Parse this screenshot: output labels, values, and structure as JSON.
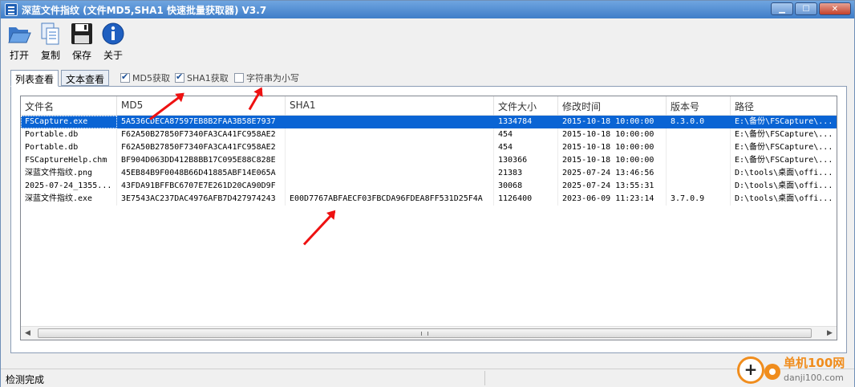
{
  "window": {
    "title": "深蓝文件指纹 (文件MD5,SHA1 快速批量获取器) V3.7",
    "minimize": "▁",
    "maximize": "☐",
    "close": "✕"
  },
  "toolbar": {
    "open_label": "打开",
    "copy_label": "复制",
    "save_label": "保存",
    "about_label": "关于"
  },
  "tabs": [
    {
      "label": "列表查看",
      "active": true
    },
    {
      "label": "文本查看",
      "active": false
    }
  ],
  "options": {
    "md5": {
      "label": "MD5获取",
      "checked": true
    },
    "sha1": {
      "label": "SHA1获取",
      "checked": true
    },
    "lowercase": {
      "label": "字符串为小写",
      "checked": false
    }
  },
  "table": {
    "columns": [
      "文件名",
      "MD5",
      "SHA1",
      "文件大小",
      "修改时间",
      "版本号",
      "路径"
    ],
    "rows": [
      [
        "FSCapture.exe",
        "5A536CDECA87597EB8B2FAA3B58E7937",
        "",
        "1334784",
        "2015-10-18 10:00:00",
        "8.3.0.0",
        "E:\\备份\\FSCapture\\..."
      ],
      [
        "Portable.db",
        "F62A50B27850F7340FA3CA41FC958AE2",
        "",
        "454",
        "2015-10-18 10:00:00",
        "",
        "E:\\备份\\FSCapture\\..."
      ],
      [
        "Portable.db",
        "F62A50B27850F7340FA3CA41FC958AE2",
        "",
        "454",
        "2015-10-18 10:00:00",
        "",
        "E:\\备份\\FSCapture\\..."
      ],
      [
        "FSCaptureHelp.chm",
        "BF904D063DD412B8BB17C095E88C828E",
        "",
        "130366",
        "2015-10-18 10:00:00",
        "",
        "E:\\备份\\FSCapture\\..."
      ],
      [
        "深蓝文件指纹.png",
        "45EB84B9F0048B66D41885ABF14E065A",
        "",
        "21383",
        "2025-07-24 13:46:56",
        "",
        "D:\\tools\\桌面\\offi..."
      ],
      [
        "2025-07-24_1355...",
        "43FDA91BFFBC6707E7E261D20CA90D9F",
        "",
        "30068",
        "2025-07-24 13:55:31",
        "",
        "D:\\tools\\桌面\\offi..."
      ],
      [
        "深蓝文件指纹.exe",
        "3E7543AC237DAC4976AFB7D427974243",
        "E00D7767ABFAECF03FBCDA96FDEA8FF531D25F4A",
        "1126400",
        "2023-06-09 11:23:14",
        "3.7.0.9",
        "D:\\tools\\桌面\\offi..."
      ]
    ],
    "selected_row": 0
  },
  "status": {
    "text": "检测完成"
  },
  "watermark": {
    "name": "单机100网",
    "url": "danji100.com"
  },
  "colors": {
    "selection": "#0a64d4",
    "arrow": "#e11111",
    "title_gradient_top": "#6fa5e0"
  }
}
